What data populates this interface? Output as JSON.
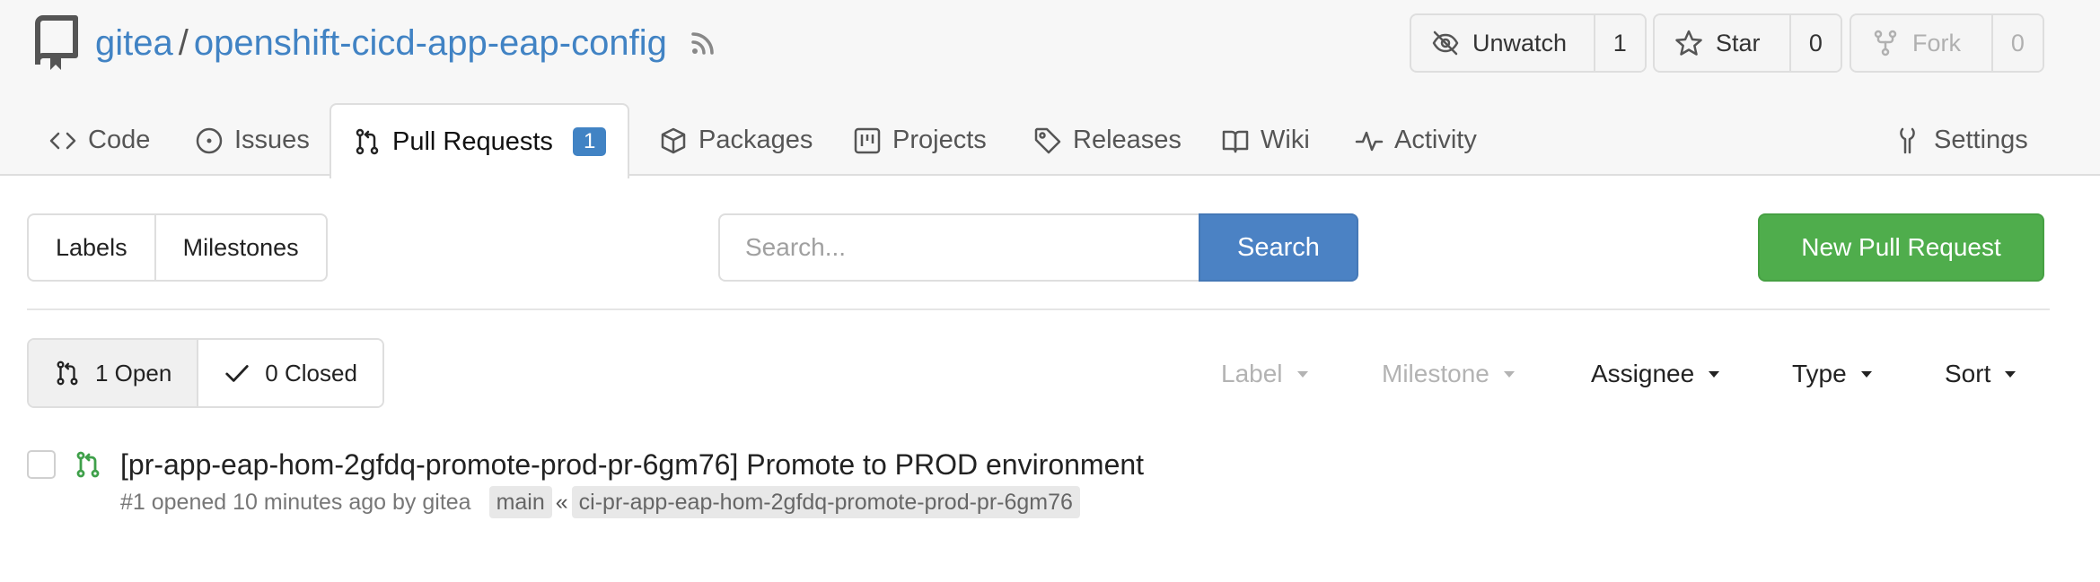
{
  "repo": {
    "owner": "gitea",
    "separator": "/",
    "name": "openshift-cicd-app-eap-config"
  },
  "actions": {
    "unwatch_label": "Unwatch",
    "unwatch_count": "1",
    "star_label": "Star",
    "star_count": "0",
    "fork_label": "Fork",
    "fork_count": "0"
  },
  "tabs": {
    "code": "Code",
    "issues": "Issues",
    "pull_requests": "Pull Requests",
    "pull_requests_count": "1",
    "packages": "Packages",
    "projects": "Projects",
    "releases": "Releases",
    "wiki": "Wiki",
    "activity": "Activity",
    "settings": "Settings"
  },
  "toolbar": {
    "labels": "Labels",
    "milestones": "Milestones",
    "search_placeholder": "Search...",
    "search_value": "",
    "search_button": "Search",
    "new_pr_button": "New Pull Request"
  },
  "state": {
    "open": "1 Open",
    "closed": "0 Closed"
  },
  "filters": {
    "label": "Label",
    "milestone": "Milestone",
    "assignee": "Assignee",
    "type": "Type",
    "sort": "Sort"
  },
  "pull_requests": [
    {
      "title": "[pr-app-eap-hom-2gfdq-promote-prod-pr-6gm76] Promote to PROD environment",
      "meta": "#1 opened 10 minutes ago by gitea",
      "base_branch": "main",
      "arrow": "«",
      "head_branch": "ci-pr-app-eap-hom-2gfdq-promote-prod-pr-6gm76"
    }
  ],
  "colors": {
    "link": "#4183c4",
    "primary": "#4b82c4",
    "success": "#4fad4c",
    "pr_icon": "#3fa04a"
  },
  "icons": {
    "repo": "repo-icon",
    "rss": "rss-icon",
    "unwatch": "eye-slash-icon",
    "star": "star-icon",
    "fork": "fork-icon",
    "code": "code-icon",
    "issues": "issue-icon",
    "pull_requests": "pull-request-icon",
    "packages": "package-icon",
    "projects": "project-icon",
    "releases": "tag-icon",
    "wiki": "book-icon",
    "activity": "pulse-icon",
    "settings": "tools-icon",
    "open": "pull-request-icon",
    "closed": "check-icon"
  }
}
